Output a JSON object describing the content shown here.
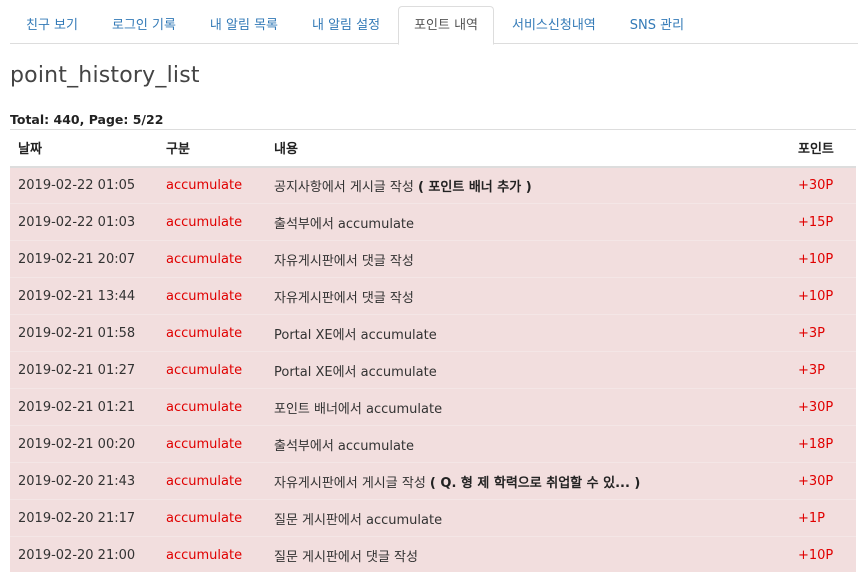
{
  "tabs": [
    {
      "label": "친구 보기",
      "active": false
    },
    {
      "label": "로그인 기록",
      "active": false
    },
    {
      "label": "내 알림 목록",
      "active": false
    },
    {
      "label": "내 알림 설정",
      "active": false
    },
    {
      "label": "포인트 내역",
      "active": true
    },
    {
      "label": "서비스신청내역",
      "active": false
    },
    {
      "label": "SNS 관리",
      "active": false
    }
  ],
  "page_title": "point_history_list",
  "summary": "Total: 440, Page: 5/22",
  "table": {
    "headers": [
      "날짜",
      "구분",
      "내용",
      "포인트"
    ],
    "rows": [
      {
        "date": "2019-02-22 01:05",
        "type": "accumulate",
        "content": "공지사항에서 게시글 작성 ",
        "content_bold": "( 포인트 배너 추가 )",
        "points": "+30P"
      },
      {
        "date": "2019-02-22 01:03",
        "type": "accumulate",
        "content": "출석부에서 accumulate",
        "content_bold": "",
        "points": "+15P"
      },
      {
        "date": "2019-02-21 20:07",
        "type": "accumulate",
        "content": "자유게시판에서 댓글 작성",
        "content_bold": "",
        "points": "+10P"
      },
      {
        "date": "2019-02-21 13:44",
        "type": "accumulate",
        "content": "자유게시판에서 댓글 작성",
        "content_bold": "",
        "points": "+10P"
      },
      {
        "date": "2019-02-21 01:58",
        "type": "accumulate",
        "content": "Portal XE에서 accumulate",
        "content_bold": "",
        "points": "+3P"
      },
      {
        "date": "2019-02-21 01:27",
        "type": "accumulate",
        "content": "Portal XE에서 accumulate",
        "content_bold": "",
        "points": "+3P"
      },
      {
        "date": "2019-02-21 01:21",
        "type": "accumulate",
        "content": "포인트 배너에서 accumulate",
        "content_bold": "",
        "points": "+30P"
      },
      {
        "date": "2019-02-21 00:20",
        "type": "accumulate",
        "content": "출석부에서 accumulate",
        "content_bold": "",
        "points": "+18P"
      },
      {
        "date": "2019-02-20 21:43",
        "type": "accumulate",
        "content": "자유게시판에서 게시글 작성 ",
        "content_bold": "( Q. 형 제 학력으로 취업할 수 있... )",
        "points": "+30P"
      },
      {
        "date": "2019-02-20 21:17",
        "type": "accumulate",
        "content": "질문 게시판에서 accumulate",
        "content_bold": "",
        "points": "+1P"
      },
      {
        "date": "2019-02-20 21:00",
        "type": "accumulate",
        "content": "질문 게시판에서 댓글 작성",
        "content_bold": "",
        "points": "+10P"
      }
    ]
  },
  "colors": {
    "link": "#337ab7",
    "row_background": "#f2dede",
    "accent_red": "#e00000"
  }
}
